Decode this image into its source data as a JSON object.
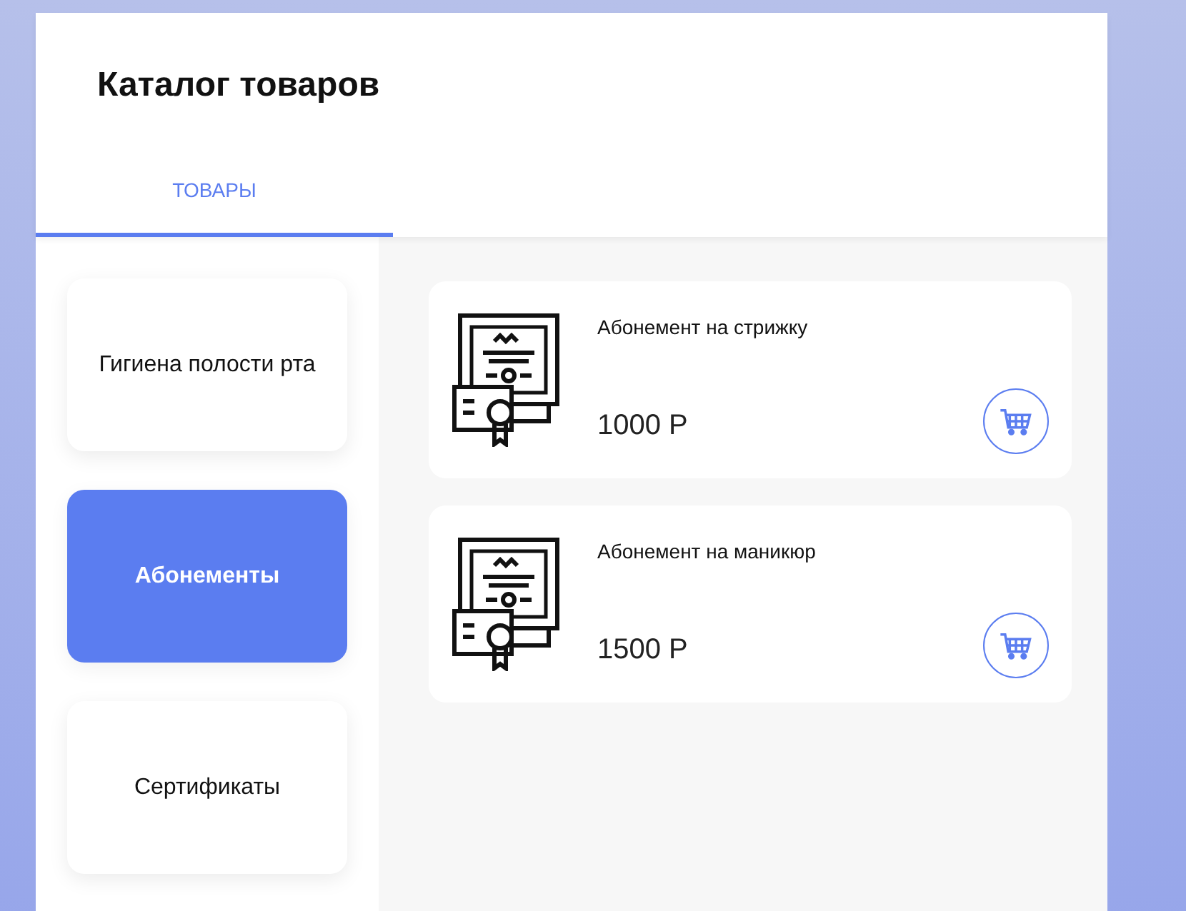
{
  "title": "Каталог товаров",
  "tabs": [
    {
      "label": "ТОВАРЫ",
      "selected": true
    }
  ],
  "categories": [
    {
      "label": "Гигиена полости рта",
      "selected": false
    },
    {
      "label": "Абонементы",
      "selected": true
    },
    {
      "label": "Сертификаты",
      "selected": false
    }
  ],
  "products": [
    {
      "name": "Абонемент на стрижку",
      "price": "1000 Р"
    },
    {
      "name": "Абонемент на маникюр",
      "price": "1500 Р"
    }
  ]
}
